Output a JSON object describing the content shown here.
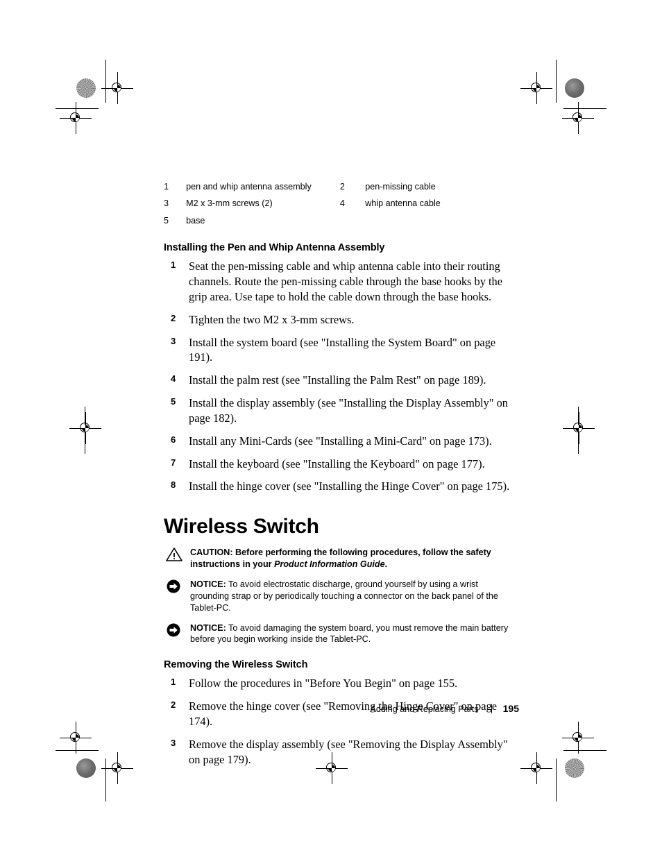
{
  "document": {
    "callout_legend": [
      {
        "num": "1",
        "text": "pen and whip antenna assembly"
      },
      {
        "num": "2",
        "text": "pen-missing cable"
      },
      {
        "num": "3",
        "text": "M2 x 3-mm screws (2)"
      },
      {
        "num": "4",
        "text": "whip antenna cable"
      },
      {
        "num": "5",
        "text": "base"
      }
    ],
    "section_install": {
      "heading": "Installing the Pen and Whip Antenna Assembly",
      "steps": [
        {
          "num": "1",
          "text": "Seat the pen-missing cable and whip antenna cable into their routing channels. Route the pen-missing cable through the base hooks by the grip area. Use tape to hold the cable down through the base hooks."
        },
        {
          "num": "2",
          "text": "Tighten the two M2 x 3-mm screws."
        },
        {
          "num": "3",
          "text": "Install the system board (see \"Installing the System Board\" on page 191)."
        },
        {
          "num": "4",
          "text": "Install the palm rest (see \"Installing the Palm Rest\" on page 189)."
        },
        {
          "num": "5",
          "text": "Install the display assembly (see \"Installing the Display Assembly\" on page 182)."
        },
        {
          "num": "6",
          "text": "Install any Mini-Cards (see \"Installing a Mini-Card\" on page 173)."
        },
        {
          "num": "7",
          "text": "Install the keyboard (see \"Installing the Keyboard\" on page 177)."
        },
        {
          "num": "8",
          "text": "Install the hinge cover (see \"Installing the Hinge Cover\" on page 175)."
        }
      ]
    },
    "chapter_title": "Wireless Switch",
    "caution": {
      "label": "CAUTION:",
      "text_before": " Before performing the following procedures, follow the safety instructions in your ",
      "italic": "Product Information Guide",
      "text_after": "."
    },
    "notices": [
      {
        "label": "NOTICE:",
        "text": " To avoid electrostatic discharge, ground yourself by using a wrist grounding strap or by periodically touching a connector on the back panel of the Tablet-PC."
      },
      {
        "label": "NOTICE:",
        "text": " To avoid damaging the system board, you must remove the main battery before you begin working inside the Tablet-PC."
      }
    ],
    "section_remove": {
      "heading": "Removing the Wireless Switch",
      "steps": [
        {
          "num": "1",
          "text": "Follow the procedures in \"Before You Begin\" on page 155."
        },
        {
          "num": "2",
          "text": "Remove the hinge cover (see \"Removing the Hinge Cover\" on page 174)."
        },
        {
          "num": "3",
          "text": "Remove the display assembly (see \"Removing the Display Assembly\" on page 179)."
        }
      ]
    },
    "footer": {
      "title": "Adding and Replacing Parts",
      "page_number": "195"
    }
  }
}
